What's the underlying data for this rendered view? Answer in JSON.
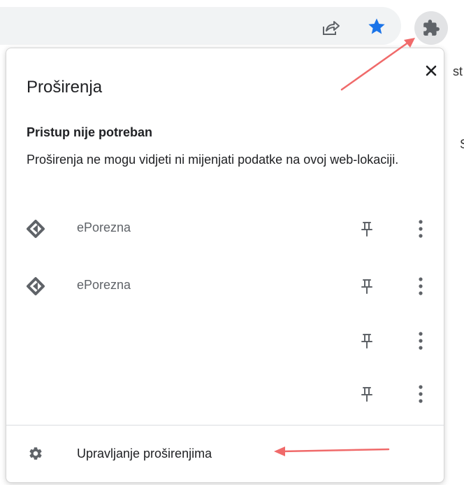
{
  "toolbar": {
    "share_icon": "share-icon",
    "bookmark_icon": "star-icon",
    "extensions_icon": "puzzle-icon"
  },
  "background_page": {
    "text_fragment_1": "st",
    "text_fragment_2": "S"
  },
  "popup": {
    "title": "Proširenja",
    "close_icon": "close-icon",
    "section_heading": "Pristup nije potreban",
    "section_description": "Proširenja ne mogu vidjeti ni mijenjati podatke na ovoj web-lokaciji.",
    "extensions": [
      {
        "name": "ePorezna",
        "has_icon": true
      },
      {
        "name": "ePorezna",
        "has_icon": true
      },
      {
        "name": "",
        "has_icon": false
      },
      {
        "name": "",
        "has_icon": false
      }
    ],
    "manage_label": "Upravljanje proširenjima"
  },
  "colors": {
    "omnibox_bg": "#f1f3f4",
    "star": "#1a73e8",
    "icon_gray": "#5f6368",
    "annotation_arrow": "#f06a6a"
  }
}
